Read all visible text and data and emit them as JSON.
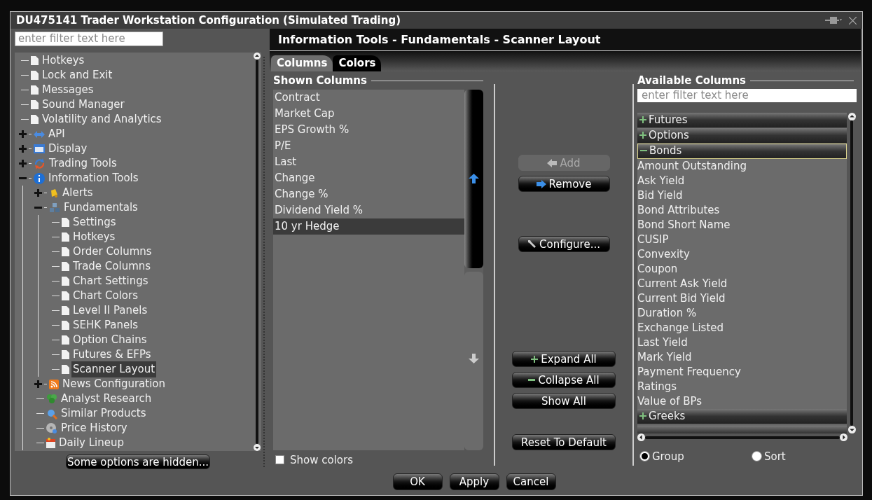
{
  "window": {
    "title": "DU475141 Trader Workstation Configuration (Simulated Trading)"
  },
  "sidebar": {
    "filter": {
      "placeholder": "enter filter text here"
    },
    "tree": [
      {
        "label": "Hotkeys",
        "kind": "page",
        "selected": false
      },
      {
        "label": "Lock and Exit",
        "kind": "page",
        "selected": false
      },
      {
        "label": "Messages",
        "kind": "page",
        "selected": false
      },
      {
        "label": "Sound Manager",
        "kind": "page",
        "selected": false
      },
      {
        "label": "Volatility and Analytics",
        "kind": "page",
        "selected": false
      },
      {
        "label": "API",
        "kind": "arrows",
        "selected": false,
        "expanded": false
      },
      {
        "label": "Display",
        "kind": "window",
        "selected": false,
        "expanded": false
      },
      {
        "label": "Trading Tools",
        "kind": "cycle",
        "selected": false,
        "expanded": false
      },
      {
        "label": "Information Tools",
        "kind": "info",
        "selected": false,
        "expanded": true,
        "children": [
          {
            "label": "Alerts",
            "kind": "bell",
            "selected": false,
            "expanded": false
          },
          {
            "label": "Fundamentals",
            "kind": "cubes",
            "selected": false,
            "expanded": true,
            "children": [
              {
                "label": "Settings",
                "kind": "page",
                "selected": false
              },
              {
                "label": "Hotkeys",
                "kind": "page",
                "selected": false
              },
              {
                "label": "Order Columns",
                "kind": "page",
                "selected": false
              },
              {
                "label": "Trade Columns",
                "kind": "page",
                "selected": false
              },
              {
                "label": "Chart Settings",
                "kind": "page",
                "selected": false
              },
              {
                "label": "Chart Colors",
                "kind": "page",
                "selected": false
              },
              {
                "label": "Level II Panels",
                "kind": "page",
                "selected": false
              },
              {
                "label": "SEHK Panels",
                "kind": "page",
                "selected": false
              },
              {
                "label": "Option Chains",
                "kind": "page",
                "selected": false
              },
              {
                "label": "Futures & EFPs",
                "kind": "page",
                "selected": false
              },
              {
                "label": "Scanner Layout",
                "kind": "page",
                "selected": true
              }
            ]
          },
          {
            "label": "News Configuration",
            "kind": "rss",
            "selected": false,
            "expanded": false
          },
          {
            "label": "Analyst Research",
            "kind": "clover",
            "selected": false
          },
          {
            "label": "Similar Products",
            "kind": "magnifier",
            "selected": false
          },
          {
            "label": "Price History",
            "kind": "disc",
            "selected": false
          },
          {
            "label": "Daily Lineup",
            "kind": "calendar",
            "selected": false
          }
        ]
      }
    ],
    "hidden_button": "Some options are hidden..."
  },
  "panel": {
    "title": "Information Tools - Fundamentals - Scanner Layout",
    "tabs": [
      {
        "label": "Columns",
        "selected": true
      },
      {
        "label": "Colors",
        "selected": false
      }
    ],
    "shown_columns": {
      "heading": "Shown Columns",
      "items": [
        {
          "label": "Contract",
          "selected": false
        },
        {
          "label": "Market Cap",
          "selected": false
        },
        {
          "label": "EPS Growth %",
          "selected": false
        },
        {
          "label": "P/E",
          "selected": false
        },
        {
          "label": "Last",
          "selected": false
        },
        {
          "label": "Change",
          "selected": false
        },
        {
          "label": "Change %",
          "selected": false
        },
        {
          "label": "Dividend Yield %",
          "selected": false
        },
        {
          "label": "10 yr Hedge",
          "selected": true
        }
      ],
      "show_colors": {
        "label": "Show colors",
        "checked": false
      }
    },
    "actions": [
      {
        "label": "Add",
        "kind": "add",
        "disabled": true
      },
      {
        "label": "Remove",
        "kind": "remove",
        "disabled": false
      },
      {
        "label": "Configure...",
        "kind": "configure",
        "disabled": false
      }
    ],
    "tree_actions": [
      {
        "label": "Expand All",
        "kind": "expand"
      },
      {
        "label": "Collapse All",
        "kind": "collapse"
      },
      {
        "label": "Show All",
        "kind": "plain"
      }
    ],
    "reset_button": "Reset To Default",
    "available_columns": {
      "heading": "Available Columns",
      "filter": {
        "placeholder": "enter filter text here"
      },
      "groups": [
        {
          "label": "Futures",
          "expanded": false,
          "selected": false
        },
        {
          "label": "Options",
          "expanded": false,
          "selected": false
        },
        {
          "label": "Bonds",
          "expanded": true,
          "selected": true,
          "children": [
            "Amount Outstanding",
            "Ask Yield",
            "Bid Yield",
            "Bond Attributes",
            "Bond Short Name",
            "CUSIP",
            "Convexity",
            "Coupon",
            "Current Ask Yield",
            "Current Bid Yield",
            "Duration %",
            "Exchange Listed",
            "Last Yield",
            "Mark Yield",
            "Payment Frequency",
            "Ratings",
            "Value of BPs"
          ]
        },
        {
          "label": "Greeks",
          "expanded": false,
          "selected": false
        }
      ],
      "view": [
        {
          "label": "Group",
          "selected": true
        },
        {
          "label": "Sort",
          "selected": false
        }
      ]
    }
  },
  "buttons": [
    "OK",
    "Apply",
    "Cancel"
  ]
}
